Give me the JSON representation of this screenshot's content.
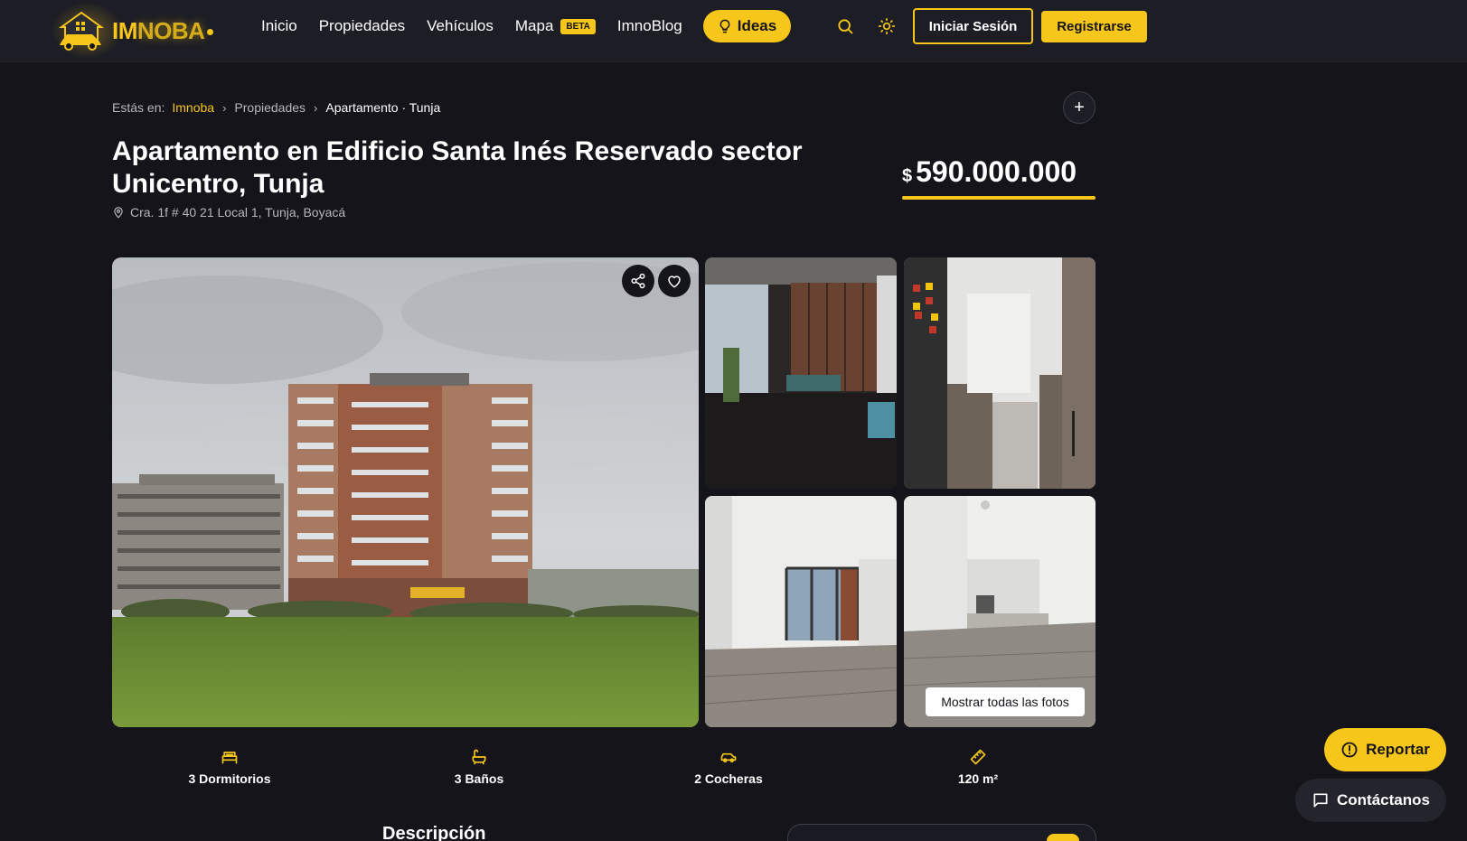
{
  "header": {
    "logo_im": "IM",
    "logo_noba": "NOBA",
    "nav": {
      "inicio": "Inicio",
      "propiedades": "Propiedades",
      "vehiculos": "Vehículos",
      "mapa": "Mapa",
      "mapa_badge": "BETA",
      "blog": "ImnoBlog"
    },
    "ideas_label": "Ideas",
    "login_label": "Iniciar Sesión",
    "register_label": "Registrarse"
  },
  "breadcrumb": {
    "prefix": "Estás en:",
    "items": [
      "Imnoba",
      "Propiedades",
      "Apartamento · Tunja"
    ]
  },
  "listing": {
    "title": "Apartamento en Edificio Santa Inés Reservado sector Unicentro, Tunja",
    "address": "Cra. 1f # 40 21 Local 1, Tunja, Boyacá",
    "price_currency": "$",
    "price_value": "590.000.000"
  },
  "gallery": {
    "show_all_label": "Mostrar todas las fotos"
  },
  "features": [
    {
      "icon": "bed-icon",
      "label": "3 Dormitorios"
    },
    {
      "icon": "bathtub-icon",
      "label": "3 Baños"
    },
    {
      "icon": "car-icon",
      "label": "2 Cocheras"
    },
    {
      "icon": "ruler-icon",
      "label": "120 m²"
    }
  ],
  "sections": {
    "description_title": "Descripción"
  },
  "floating": {
    "report_label": "Reportar",
    "contact_label": "Contáctanos"
  },
  "colors": {
    "accent": "#f7c61a",
    "background": "#14141a",
    "header": "#1c1d25"
  }
}
